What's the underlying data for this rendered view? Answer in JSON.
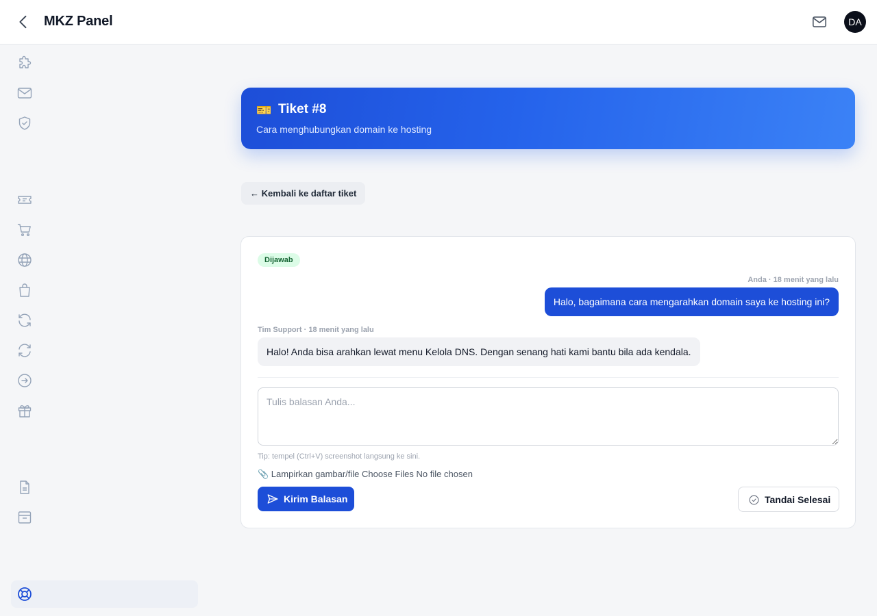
{
  "header": {
    "title": "MKZ Panel",
    "avatar_initials": "DA",
    "icons": [
      "chevron-left-icon",
      "mail-icon"
    ]
  },
  "sidebar": {
    "icons": [
      "puzzle-icon",
      "mail-icon",
      "shield-check-icon",
      "ticket-icon",
      "cart-icon",
      "globe-icon",
      "shopping-bag-icon",
      "refresh-icon",
      "sync-icon",
      "arrow-circle-right-icon",
      "gift-icon",
      "document-icon",
      "archive-icon",
      "life-buoy-icon"
    ],
    "active_icon": "life-buoy-icon"
  },
  "ticket": {
    "emoji": "🎫",
    "title": "Tiket #8",
    "subject": "Cara menghubungkan domain ke hosting",
    "back_label": "← Kembali ke daftar tiket",
    "status": "Dijawab"
  },
  "messages": [
    {
      "author_meta": "Anda · 18 menit yang lalu",
      "text": "Halo, bagaimana cara mengarahkan domain saya ke hosting ini?"
    },
    {
      "author_meta": "Tim Support · 18 menit yang lalu",
      "text": "Halo! Anda bisa arahkan lewat menu Kelola DNS. Dengan senang hati kami bantu bila ada kendala."
    }
  ],
  "reply": {
    "placeholder": "Tulis balasan Anda...",
    "value": "",
    "tip": "Tip: tempel (Ctrl+V) screenshot langsung ke sini.",
    "attach_label": "📎 Lampirkan gambar/file",
    "file_button": "Choose Files",
    "file_status": "No file chosen",
    "send_label": "Kirim Balasan",
    "done_label": "Tandai Selesai"
  },
  "colors": {
    "accent": "#1d4ed8",
    "background": "#f5f6f8",
    "status_bg": "#dcfce7",
    "status_text": "#166534"
  }
}
